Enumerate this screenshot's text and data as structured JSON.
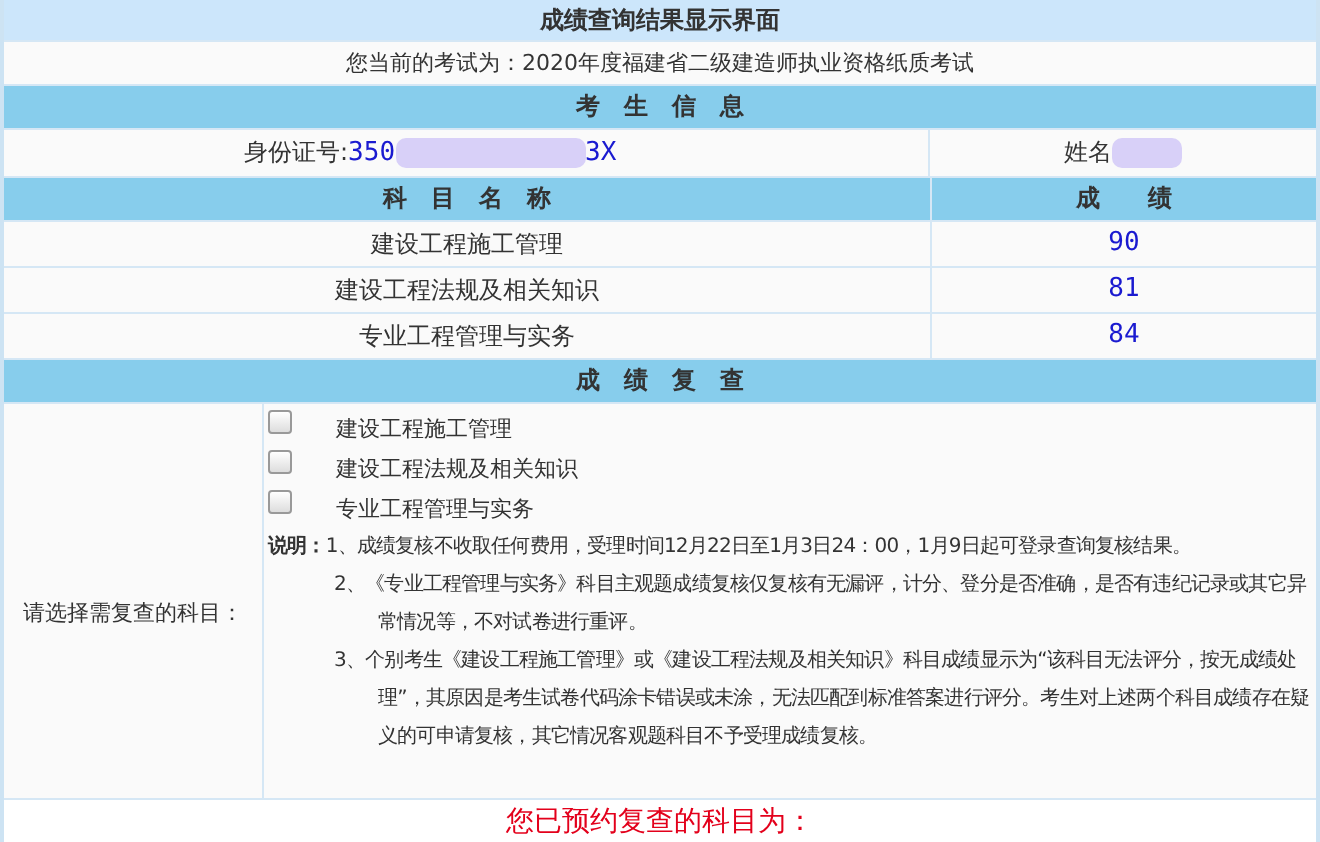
{
  "title": "成绩查询结果显示界面",
  "exam": {
    "label": "您当前的考试为：",
    "value": "2020年度福建省二级建造师执业资格纸质考试"
  },
  "candidate_header": "考　生　信　息",
  "id_field": {
    "label": "身份证号:",
    "prefix": "350",
    "suffix": "3X"
  },
  "name_field": {
    "label": "姓名"
  },
  "score_table": {
    "columns": [
      "科　目　名　称",
      "成　　绩"
    ],
    "rows": [
      {
        "subject": "建设工程施工管理",
        "score": "90"
      },
      {
        "subject": "建设工程法规及相关知识",
        "score": "81"
      },
      {
        "subject": "专业工程管理与实务",
        "score": "84"
      }
    ]
  },
  "review_header": "成　绩　复　查",
  "review": {
    "label": "请选择需复查的科目：",
    "options": [
      {
        "label": "建设工程施工管理",
        "checked": false
      },
      {
        "label": "建设工程法规及相关知识",
        "checked": false
      },
      {
        "label": "专业工程管理与实务",
        "checked": false
      }
    ],
    "notes_title": "说明：",
    "notes": [
      "1、成绩复核不收取任何费用，受理时间12月22日至1月3日24：00，1月9日起可登录查询复核结果。",
      "2、《专业工程管理与实务》科目主观题成绩复核仅复核有无漏评，计分、登分是否准确，是否有违纪记录或其它异常情况等，不对试卷进行重评。",
      "3、个别考生《建设工程施工管理》或《建设工程法规及相关知识》科目成绩显示为“该科目无法评分，按无成绩处理”，其原因是考生试卷代码涂卡错误或未涂，无法匹配到标准答案进行评分。考生对上述两个科目成绩存在疑义的可申请复核，其它情况客观题科目不予受理成绩复核。"
    ]
  },
  "booked_title": "您已预约复查的科目为："
}
